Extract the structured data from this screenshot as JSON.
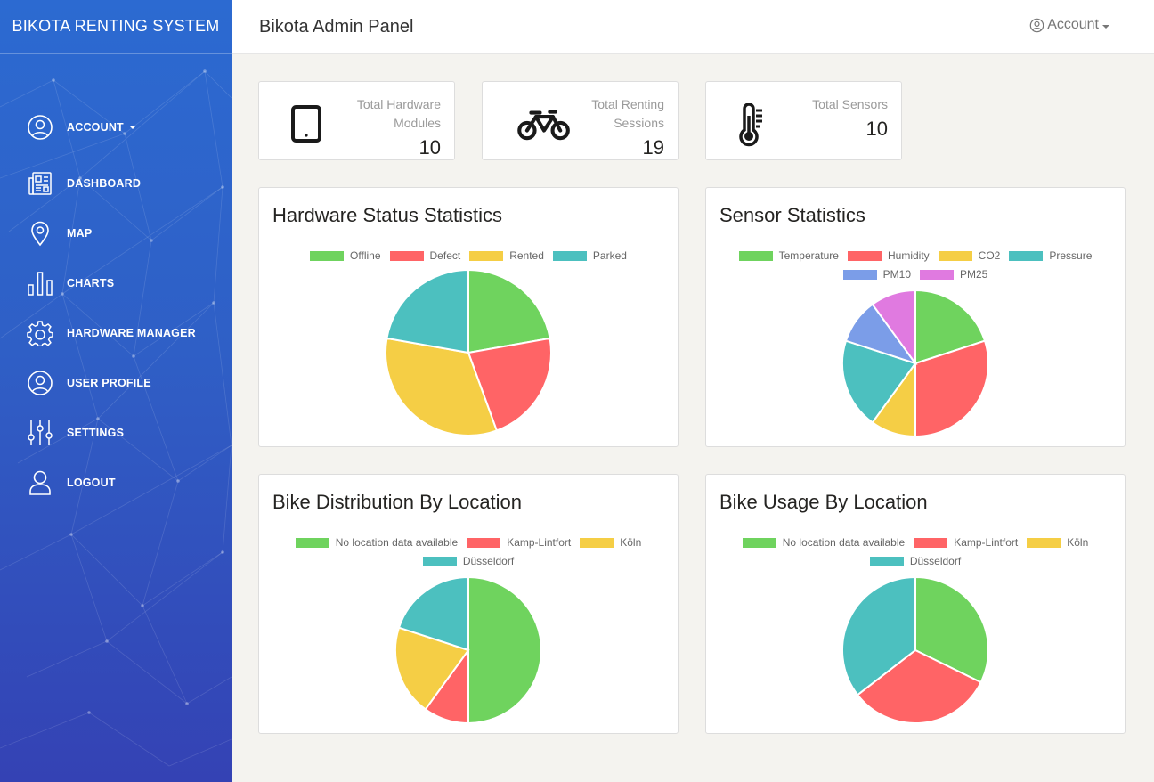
{
  "sidebar": {
    "brand": "BIKOTA RENTING SYSTEM",
    "items": [
      {
        "label": "ACCOUNT",
        "icon": "user-circle-icon"
      },
      {
        "label": "DASHBOARD",
        "icon": "dashboard-icon"
      },
      {
        "label": "MAP",
        "icon": "map-pin-icon"
      },
      {
        "label": "CHARTS",
        "icon": "bar-chart-icon"
      },
      {
        "label": "HARDWARE MANAGER",
        "icon": "gear-icon"
      },
      {
        "label": "USER PROFILE",
        "icon": "user-circle-icon"
      },
      {
        "label": "SETTINGS",
        "icon": "sliders-icon"
      },
      {
        "label": "LOGOUT",
        "icon": "user-icon"
      }
    ]
  },
  "header": {
    "title": "Bikota Admin Panel",
    "account_label": "Account"
  },
  "stats": [
    {
      "label": "Total Hardware Modules",
      "value": "10",
      "icon": "tablet-icon"
    },
    {
      "label": "Total Renting Sessions",
      "value": "19",
      "icon": "bicycle-icon"
    },
    {
      "label": "Total Sensors",
      "value": "10",
      "icon": "thermometer-icon"
    }
  ],
  "colors": {
    "green": "#6fd35e",
    "red": "#ff6466",
    "yellow": "#f5ce45",
    "teal": "#4cc0bf",
    "blue": "#7b9de8",
    "purple": "#e07ae0"
  },
  "charts": [
    {
      "title": "Hardware Status Statistics",
      "chart_data": {
        "type": "pie",
        "categories": [
          "Offline",
          "Defect",
          "Rented",
          "Parked"
        ],
        "values": [
          2,
          2,
          3,
          2
        ],
        "colors": [
          "#6fd35e",
          "#ff6466",
          "#f5ce45",
          "#4cc0bf"
        ],
        "legend": "top"
      }
    },
    {
      "title": "Sensor Statistics",
      "chart_data": {
        "type": "pie",
        "categories": [
          "Temperature",
          "Humidity",
          "CO2",
          "Pressure",
          "PM10",
          "PM25"
        ],
        "values": [
          1.8,
          2.7,
          0.9,
          1.8,
          0.9,
          0.9
        ],
        "colors": [
          "#6fd35e",
          "#ff6466",
          "#f5ce45",
          "#4cc0bf",
          "#7b9de8",
          "#e07ae0"
        ],
        "legend": "top"
      }
    },
    {
      "title": "Bike Distribution By Location",
      "chart_data": {
        "type": "pie",
        "categories": [
          "No location data available",
          "Kamp-Lintfort",
          "Köln",
          "Düsseldorf"
        ],
        "values": [
          5,
          1,
          2,
          2
        ],
        "colors": [
          "#6fd35e",
          "#ff6466",
          "#f5ce45",
          "#4cc0bf"
        ],
        "legend": "top"
      }
    },
    {
      "title": "Bike Usage By Location",
      "chart_data": {
        "type": "pie",
        "categories": [
          "No location data available",
          "Kamp-Lintfort",
          "Köln",
          "Düsseldorf"
        ],
        "values": [
          1,
          1,
          0,
          1.1
        ],
        "colors": [
          "#6fd35e",
          "#ff6466",
          "#f5ce45",
          "#4cc0bf"
        ],
        "legend": "top"
      }
    }
  ]
}
